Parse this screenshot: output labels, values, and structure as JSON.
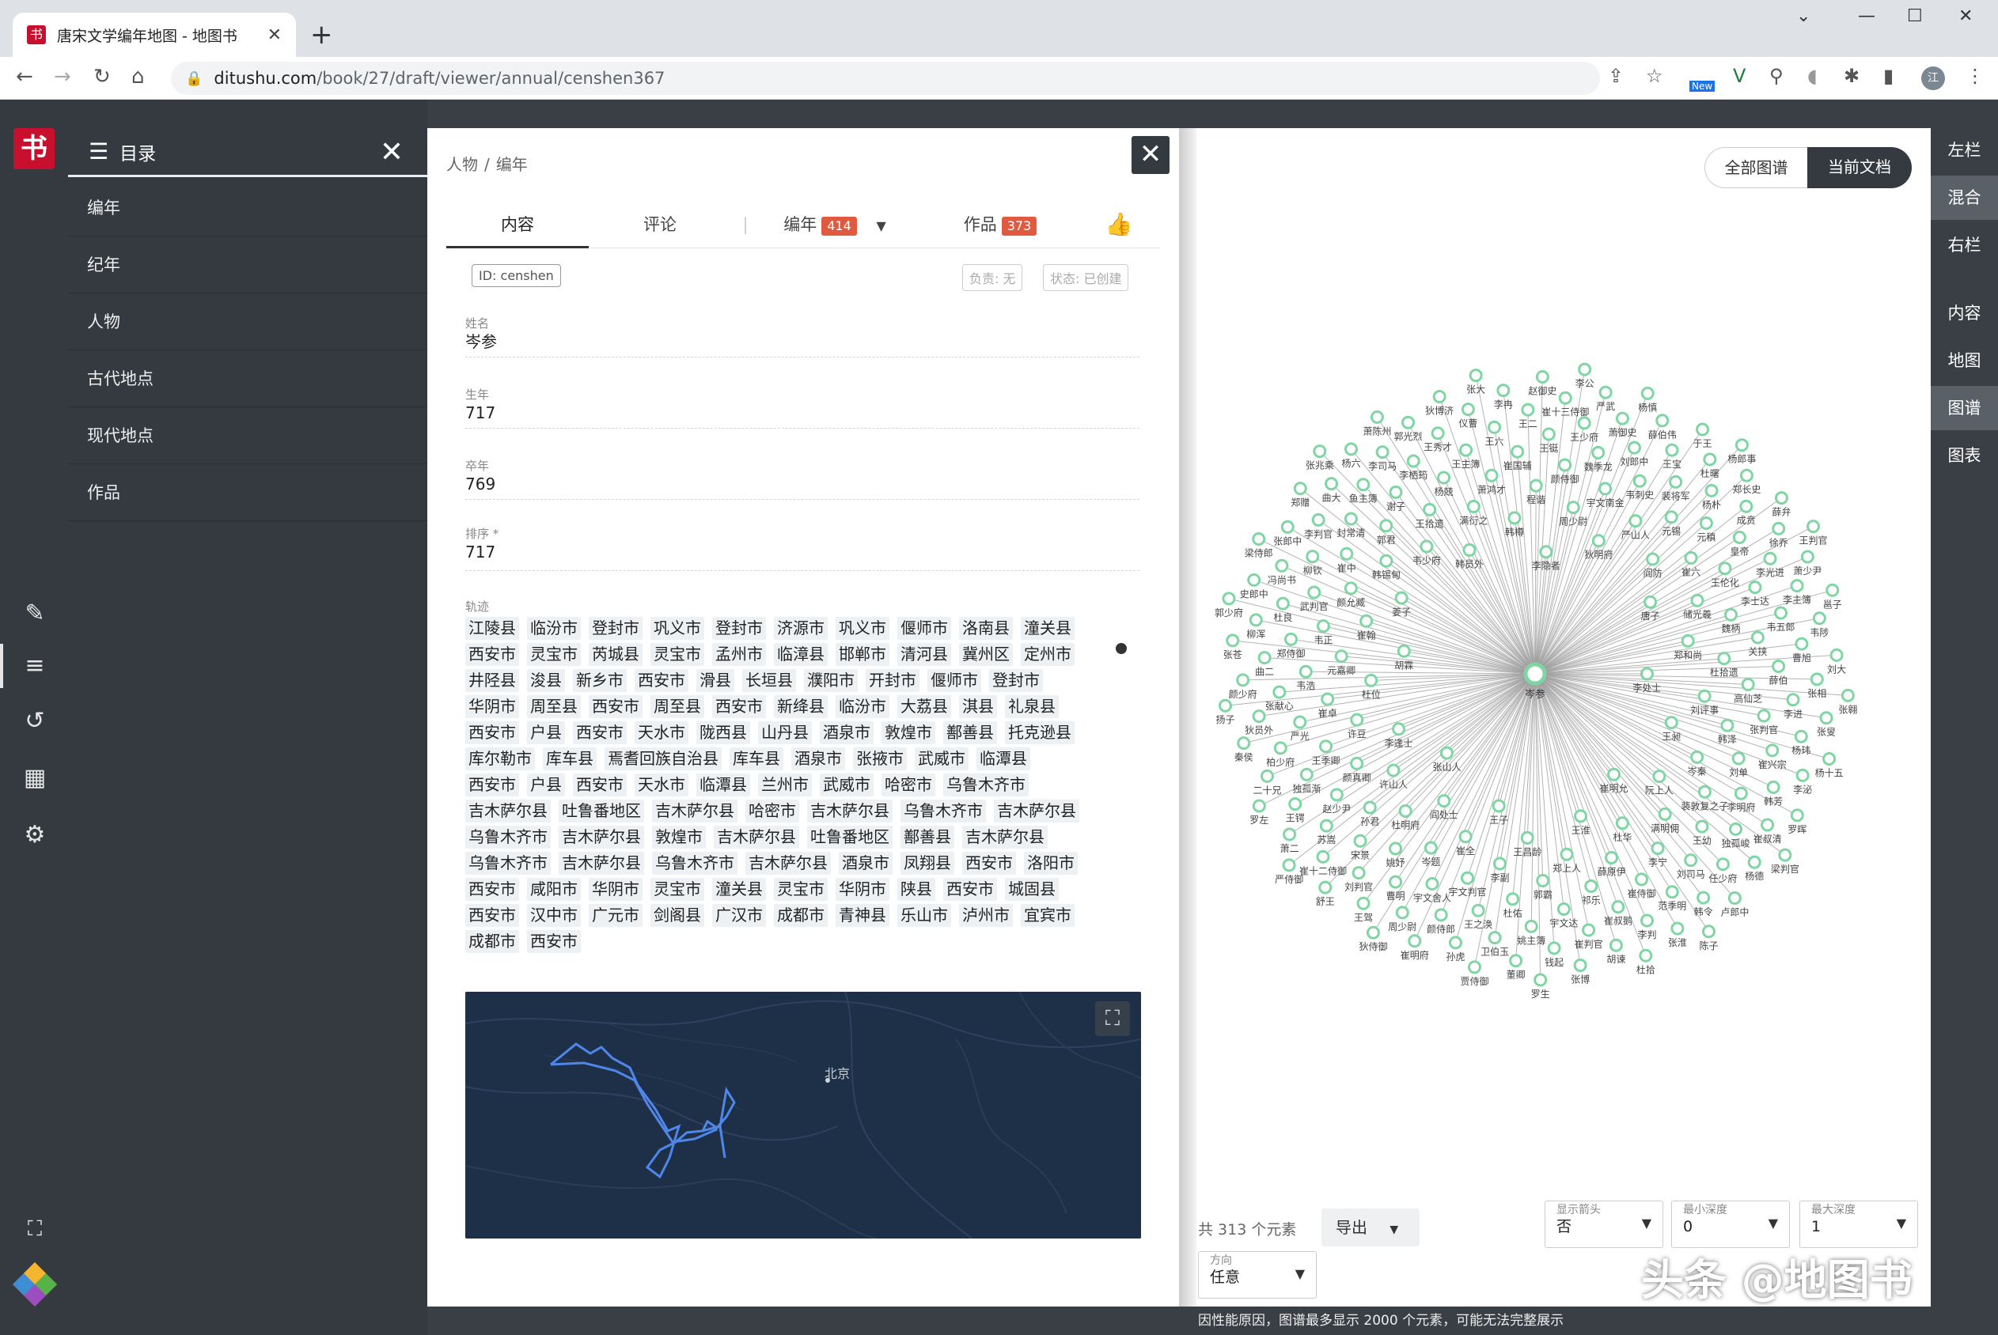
{
  "browser": {
    "tab_title": "唐宋文学编年地图 - 地图书",
    "url_host": "ditushu.com",
    "url_path": "/book/27/draft/viewer/annual/censhen367",
    "ext_new_label": "New",
    "profile_initial": "江"
  },
  "sidebar": {
    "title": "目录",
    "items": [
      "编年",
      "纪年",
      "人物",
      "古代地点",
      "现代地点",
      "作品"
    ]
  },
  "main": {
    "breadcrumb": [
      "人物",
      "编年"
    ],
    "tabs": {
      "content": "内容",
      "comments": "评论",
      "annual": "编年",
      "annual_count": "414",
      "works": "作品",
      "works_count": "373"
    },
    "id_tag": "ID: censhen",
    "owner_tag": "负责: 无",
    "status_tag": "状态: 已创建",
    "fields": [
      {
        "label": "姓名",
        "value": "岑参"
      },
      {
        "label": "生年",
        "value": "717"
      },
      {
        "label": "卒年",
        "value": "769"
      },
      {
        "label": "排序 *",
        "value": "717"
      }
    ],
    "track_label": "轨迹",
    "track": [
      "江陵县",
      "临汾市",
      "登封市",
      "巩义市",
      "登封市",
      "济源市",
      "巩义市",
      "偃师市",
      "洛南县",
      "潼关县",
      "西安市",
      "灵宝市",
      "芮城县",
      "灵宝市",
      "孟州市",
      "临漳县",
      "邯郸市",
      "清河县",
      "冀州区",
      "定州市",
      "井陉县",
      "浚县",
      "新乡市",
      "西安市",
      "滑县",
      "长垣县",
      "濮阳市",
      "开封市",
      "偃师市",
      "登封市",
      "华阴市",
      "周至县",
      "西安市",
      "周至县",
      "西安市",
      "新绛县",
      "临汾市",
      "大荔县",
      "淇县",
      "礼泉县",
      "西安市",
      "户县",
      "西安市",
      "天水市",
      "陇西县",
      "山丹县",
      "酒泉市",
      "敦煌市",
      "鄯善县",
      "托克逊县",
      "库尔勒市",
      "库车县",
      "焉耆回族自治县",
      "库车县",
      "酒泉市",
      "张掖市",
      "武威市",
      "临潭县",
      "西安市",
      "户县",
      "西安市",
      "天水市",
      "临潭县",
      "兰州市",
      "武威市",
      "哈密市",
      "乌鲁木齐市",
      "吉木萨尔县",
      "吐鲁番地区",
      "吉木萨尔县",
      "哈密市",
      "吉木萨尔县",
      "乌鲁木齐市",
      "吉木萨尔县",
      "乌鲁木齐市",
      "吉木萨尔县",
      "敦煌市",
      "吉木萨尔县",
      "吐鲁番地区",
      "鄯善县",
      "吉木萨尔县",
      "乌鲁木齐市",
      "吉木萨尔县",
      "乌鲁木齐市",
      "吉木萨尔县",
      "酒泉市",
      "凤翔县",
      "西安市",
      "洛阳市",
      "西安市",
      "咸阳市",
      "华阴市",
      "灵宝市",
      "潼关县",
      "灵宝市",
      "华阴市",
      "陕县",
      "西安市",
      "城固县",
      "西安市",
      "汉中市",
      "广元市",
      "剑阁县",
      "广汉市",
      "成都市",
      "青神县",
      "乐山市",
      "泸州市",
      "宜宾市",
      "成都市",
      "西安市"
    ],
    "map_label": "北京"
  },
  "graph": {
    "btn_all": "全部图谱",
    "btn_current": "当前文档",
    "center_label": "岑参",
    "node_color": "#7fd6a3",
    "edge_color": "#999999",
    "nodes": [
      "李处士",
      "张山人",
      "李隐者",
      "崔明允",
      "胡霖",
      "唐子",
      "王子",
      "韩员外",
      "王昶",
      "李逢士",
      "狄明府",
      "王淮",
      "姜子",
      "郑和尚",
      "阎处士",
      "韩樽",
      "阮上人",
      "杜位",
      "阎防",
      "王昌龄",
      "韦少府",
      "刘评事",
      "许山人",
      "周少尉",
      "杜华",
      "崔翰",
      "储光羲",
      "崔全",
      "满衍之",
      "岑秦",
      "许豆",
      "严山人",
      "郑上人",
      "韩锡甸",
      "杜拾遗",
      "杜明府",
      "程谐",
      "满明佣",
      "元嘉卿",
      "崔六",
      "李副",
      "王拾遗",
      "韩泽",
      "颜真卿",
      "宇文南金",
      "薛原伊",
      "颜允臧",
      "魏柄",
      "岑题",
      "萧鸿才",
      "裴敦复之子",
      "崔卓",
      "元锡",
      "郭霸",
      "郭君",
      "高仙芝",
      "孙君",
      "颜侍御",
      "李宁",
      "韦正",
      "王伦化",
      "宇文判官",
      "杨兢",
      "刘单",
      "王季卿",
      "韦刺史",
      "祁乐",
      "崔中",
      "关挟",
      "姚妤",
      "崔国辅",
      "王幼",
      "韦浩",
      "元稹",
      "杜佑",
      "谢子",
      "张判官",
      "赵少尹",
      "魏季龙",
      "崔侍御",
      "武判官",
      "李士达",
      "宇文舍人",
      "王主簿",
      "李明府",
      "严光",
      "裴将军",
      "宇文达",
      "封常清",
      "薛伯",
      "宋景",
      "王铤",
      "刘司马",
      "郑侍御",
      "皇帝",
      "王之涣",
      "李栖筠",
      "崔兴宗",
      "独孤渐",
      "刘郎中",
      "崔叔鹅",
      "柳钦",
      "韦五郎",
      "曹明",
      "王六",
      "独孤峻",
      "张献心",
      "杨朴",
      "姚主簿",
      "鱼主簿",
      "李进",
      "苏嵩",
      "王少府",
      "范季明",
      "杜良",
      "李光进",
      "颜侍郎",
      "王秀才",
      "韩芳",
      "柏少府",
      "王宝",
      "崔判官",
      "李判官",
      "曹旭",
      "刘判官",
      "王二",
      "任少府",
      "曲二",
      "成贲",
      "卫伯玉",
      "李司马",
      "杨玮",
      "王锷",
      "萧御史",
      "李判",
      "冯尚书",
      "李主簿",
      "周少尉",
      "仪曹",
      "崔叔清",
      "狄员外",
      "杜曙",
      "钱起",
      "曲大",
      "张相",
      "崔十二侍御",
      "崔十三侍御",
      "韩令",
      "柳浑",
      "徐乔",
      "孙虎",
      "郭光烈",
      "李泌",
      "二十兄",
      "薛伯伟",
      "胡谏",
      "张郎中",
      "韦陟",
      "王驾",
      "李冉",
      "杨德",
      "颜少府",
      "郑长史",
      "董卿",
      "杨六",
      "张叟",
      "萧二",
      "严武",
      "张淮",
      "史郎中",
      "萧少尹",
      "崔明府",
      "狄博济",
      "罗晖",
      "秦侯",
      "于王",
      "张博",
      "郑赠",
      "刘大",
      "舒王",
      "赵御史",
      "卢郎中",
      "张苍",
      "薛弁",
      "贾侍御",
      "萧陈州",
      "杨十五",
      "罗左",
      "杨慎",
      "杜拾",
      "梁侍郎",
      "邕子",
      "狄侍御",
      "张大",
      "梁判官",
      "扬子",
      "杨郎事",
      "罗生",
      "张兆乘",
      "张翱",
      "严侍御",
      "李公",
      "陈子",
      "郭少府",
      "王判官"
    ],
    "element_count_text": "共 313 个元素",
    "export_label": "导出",
    "filters": [
      {
        "label": "显示箭头",
        "value": "否"
      },
      {
        "label": "最小深度",
        "value": "0"
      },
      {
        "label": "最大深度",
        "value": "1"
      },
      {
        "label": "方向",
        "value": "任意"
      }
    ],
    "notice": "因性能原因，图谱最多显示 2000 个元素，可能无法完整展示"
  },
  "rightbar": {
    "items": [
      "左栏",
      "混合",
      "右栏",
      "内容",
      "地图",
      "图谱",
      "图表"
    ],
    "active": [
      "混合",
      "图谱"
    ]
  },
  "watermark": "头条 @地图书"
}
